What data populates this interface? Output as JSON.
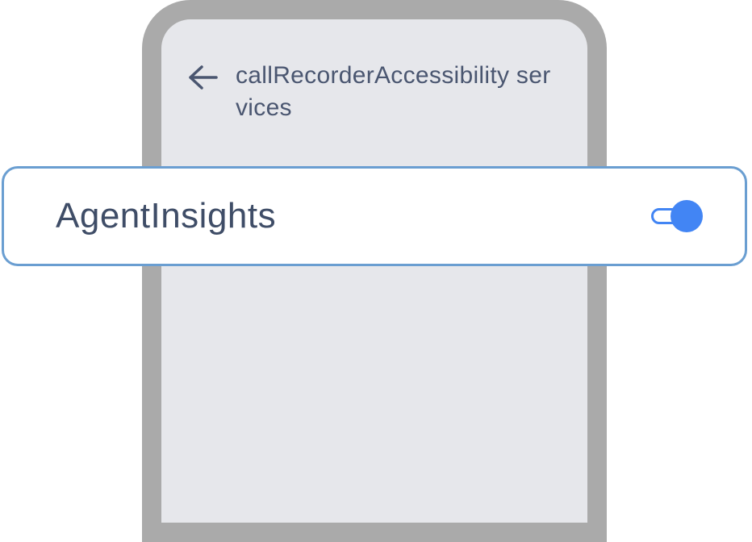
{
  "header": {
    "title": "callRecorderAccessibility services",
    "back_icon": "arrow-left-icon"
  },
  "setting": {
    "label": "AgentInsights",
    "toggle_state": "on"
  },
  "colors": {
    "frame": "#aaaaaa",
    "screen": "#e6e7eb",
    "card_border": "#6a9ed1",
    "toggle_accent": "#4285f4",
    "text": "#4a5670"
  }
}
